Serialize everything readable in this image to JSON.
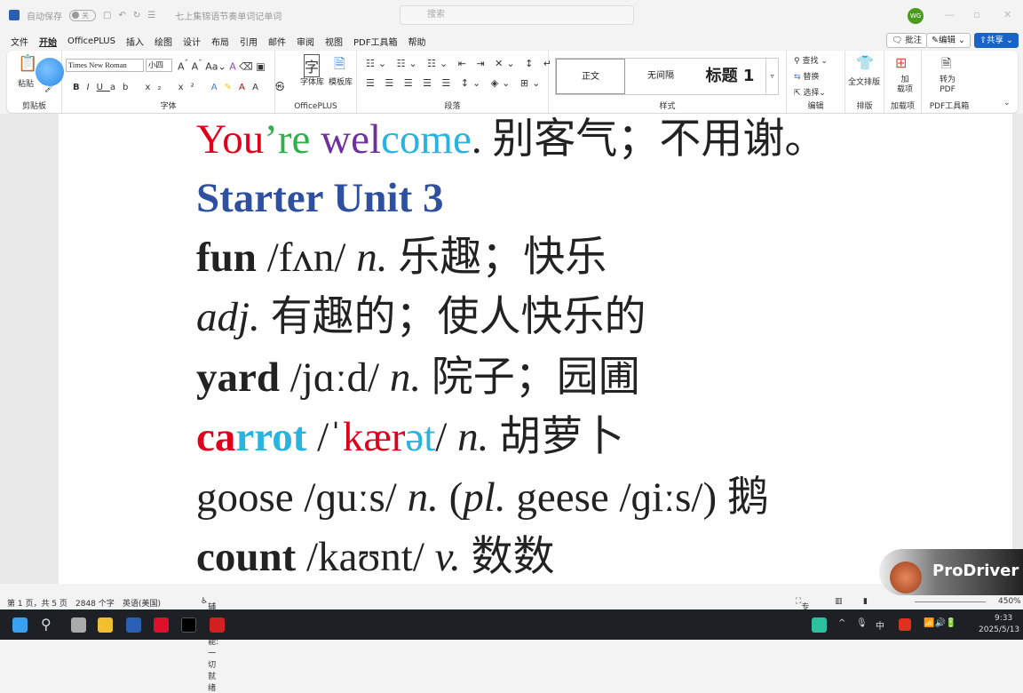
{
  "titlebar": {
    "autosave": "自动保存",
    "autosave_state": "关",
    "doc_title": "七上集锦语节奏单词记单词",
    "search_placeholder": "搜索",
    "avatar": "WG"
  },
  "menu": [
    "文件",
    "开始",
    "OfficePLUS",
    "插入",
    "绘图",
    "设计",
    "布局",
    "引用",
    "邮件",
    "审阅",
    "视图",
    "PDF工具箱",
    "帮助"
  ],
  "menu_active": 1,
  "right_buttons": {
    "comment": "批注",
    "edit": "编辑",
    "share": "共享"
  },
  "ribbon": {
    "clipboard": {
      "paste": "粘贴",
      "label": "剪贴板"
    },
    "font": {
      "name": "Times New Roman",
      "size": "小四",
      "label": "字体"
    },
    "officeplus": {
      "fontlib": "字体库",
      "templatelib": "模板库",
      "label": "OfficePLUS"
    },
    "paragraph": {
      "label": "段落"
    },
    "styles": {
      "items": [
        "正文",
        "无间隔",
        "标题 1"
      ],
      "label": "样式"
    },
    "editing": {
      "find": "查找",
      "replace": "替换",
      "select": "选择",
      "label": "编辑"
    },
    "layout": {
      "full": "全文排版",
      "label": "排版"
    },
    "addins": {
      "btn": "加\n载项",
      "label": "加载项"
    },
    "pdf": {
      "btn": "转为\nPDF",
      "label": "PDF工具箱"
    }
  },
  "document": {
    "lines": [
      [
        {
          "t": "You",
          "c": "#e0001b"
        },
        {
          "t": "’re",
          "c": "#2db24a"
        },
        {
          "t": " wel",
          "c": "#7030a0"
        },
        {
          "t": "come",
          "c": "#27b4e0"
        },
        {
          "t": ".  别客气；不用谢。"
        }
      ],
      [
        {
          "t": "Starter Unit 3",
          "c": "#2f4f9f",
          "b": true
        }
      ],
      [
        {
          "t": "fun",
          "b": true
        },
        {
          "t": " /fʌn/ "
        },
        {
          "t": "n.",
          "i": true
        },
        {
          "t": "  乐趣；快乐"
        }
      ],
      [
        {
          "t": "adj.",
          "i": true
        },
        {
          "t": "  有趣的；使人快乐的"
        }
      ],
      [
        {
          "t": "yard",
          "b": true
        },
        {
          "t": " /jɑːd/ "
        },
        {
          "t": "n.",
          "i": true
        },
        {
          "t": "  院子；园圃"
        }
      ],
      [
        {
          "t": "ca",
          "c": "#e0001b",
          "b": true
        },
        {
          "t": "rrot",
          "c": "#27b4e0",
          "b": true
        },
        {
          "t": " /ˈ"
        },
        {
          "t": "kær",
          "c": "#e0001b"
        },
        {
          "t": "ət",
          "c": "#27b4e0"
        },
        {
          "t": "/ "
        },
        {
          "t": "n.",
          "i": true
        },
        {
          "t": "  胡萝卜"
        }
      ],
      [
        {
          "t": "goose /ɡuːs/ "
        },
        {
          "t": "n.",
          "i": true
        },
        {
          "t": " ("
        },
        {
          "t": "pl.",
          "i": true
        },
        {
          "t": " geese /ɡiːs/)  鹅"
        }
      ],
      [
        {
          "t": "count",
          "b": true
        },
        {
          "t": " /kaʊnt/ "
        },
        {
          "t": "v.",
          "i": true
        },
        {
          "t": "  数数"
        }
      ]
    ]
  },
  "status": {
    "page": "第 1 页，共 5 页",
    "words": "2848 个字",
    "lang": "英语(美国)",
    "accessibility": "辅助功能: 一切就绪",
    "focus": "专注",
    "zoom": "450%"
  },
  "overlay": {
    "logo_text": "ProDriver"
  },
  "taskbar": {
    "ime": "中",
    "time": "9:33",
    "date": "2025/5/13"
  }
}
